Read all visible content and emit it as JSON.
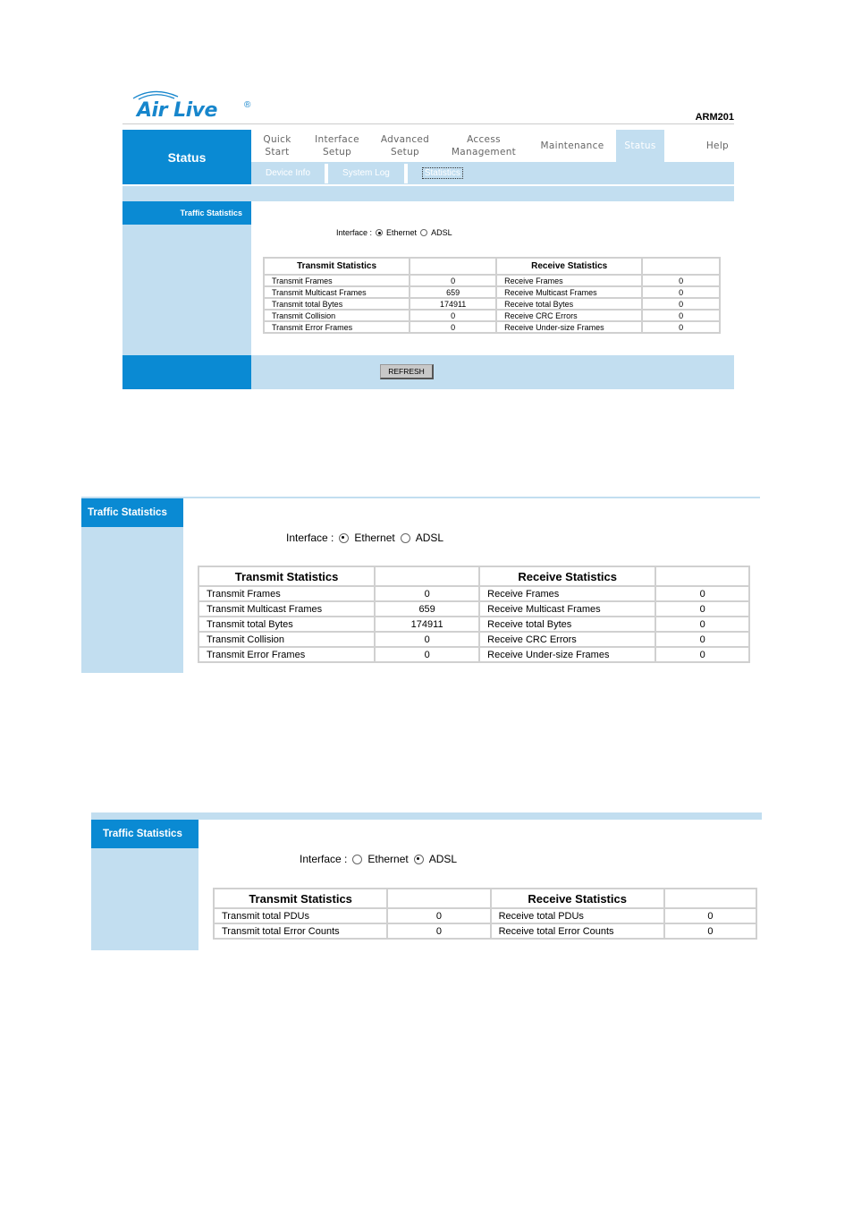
{
  "header": {
    "brand": "Air Live",
    "brand_reg": "®",
    "model": "ARM201",
    "section_title": "Status"
  },
  "nav": {
    "items": [
      {
        "label": "Quick\nStart",
        "active": false
      },
      {
        "label": "Interface\nSetup",
        "active": false
      },
      {
        "label": "Advanced\nSetup",
        "active": false
      },
      {
        "label": "Access\nManagement",
        "active": false
      },
      {
        "label": "Maintenance",
        "active": false
      },
      {
        "label": "Status",
        "active": true
      },
      {
        "label": "Help",
        "active": false
      }
    ],
    "subnav": [
      "Device Info",
      "System Log",
      "Statistics"
    ],
    "subnav_selected": "Statistics"
  },
  "colors": {
    "accent": "#0a8ad3",
    "light": "#c2def0"
  },
  "panel1": {
    "side_title": "Traffic Statistics",
    "interface_label": "Interface :",
    "interface_options": [
      "Ethernet",
      "ADSL"
    ],
    "interface_selected": "Ethernet",
    "table": {
      "headers": [
        "Transmit Statistics",
        "",
        "Receive Statistics",
        ""
      ],
      "rows": [
        [
          "Transmit Frames",
          "0",
          "Receive Frames",
          "0"
        ],
        [
          "Transmit Multicast Frames",
          "659",
          "Receive Multicast Frames",
          "0"
        ],
        [
          "Transmit total Bytes",
          "174911",
          "Receive total Bytes",
          "0"
        ],
        [
          "Transmit Collision",
          "0",
          "Receive CRC Errors",
          "0"
        ],
        [
          "Transmit Error Frames",
          "0",
          "Receive Under-size Frames",
          "0"
        ]
      ]
    },
    "refresh_label": "REFRESH"
  },
  "panel2": {
    "side_title": "Traffic Statistics",
    "interface_label": "Interface :",
    "interface_options": [
      "Ethernet",
      "ADSL"
    ],
    "interface_selected": "Ethernet",
    "table": {
      "headers": [
        "Transmit Statistics",
        "",
        "Receive Statistics",
        ""
      ],
      "rows": [
        [
          "Transmit Frames",
          "0",
          "Receive Frames",
          "0"
        ],
        [
          "Transmit Multicast Frames",
          "659",
          "Receive Multicast Frames",
          "0"
        ],
        [
          "Transmit total Bytes",
          "174911",
          "Receive total Bytes",
          "0"
        ],
        [
          "Transmit Collision",
          "0",
          "Receive CRC Errors",
          "0"
        ],
        [
          "Transmit Error Frames",
          "0",
          "Receive Under-size Frames",
          "0"
        ]
      ]
    }
  },
  "panel3": {
    "side_title": "Traffic Statistics",
    "interface_label": "Interface :",
    "interface_options": [
      "Ethernet",
      "ADSL"
    ],
    "interface_selected": "ADSL",
    "table": {
      "headers": [
        "Transmit Statistics",
        "",
        "Receive Statistics",
        ""
      ],
      "rows": [
        [
          "Transmit total PDUs",
          "0",
          "Receive total PDUs",
          "0"
        ],
        [
          "Transmit total Error Counts",
          "0",
          "Receive total Error Counts",
          "0"
        ]
      ]
    }
  }
}
